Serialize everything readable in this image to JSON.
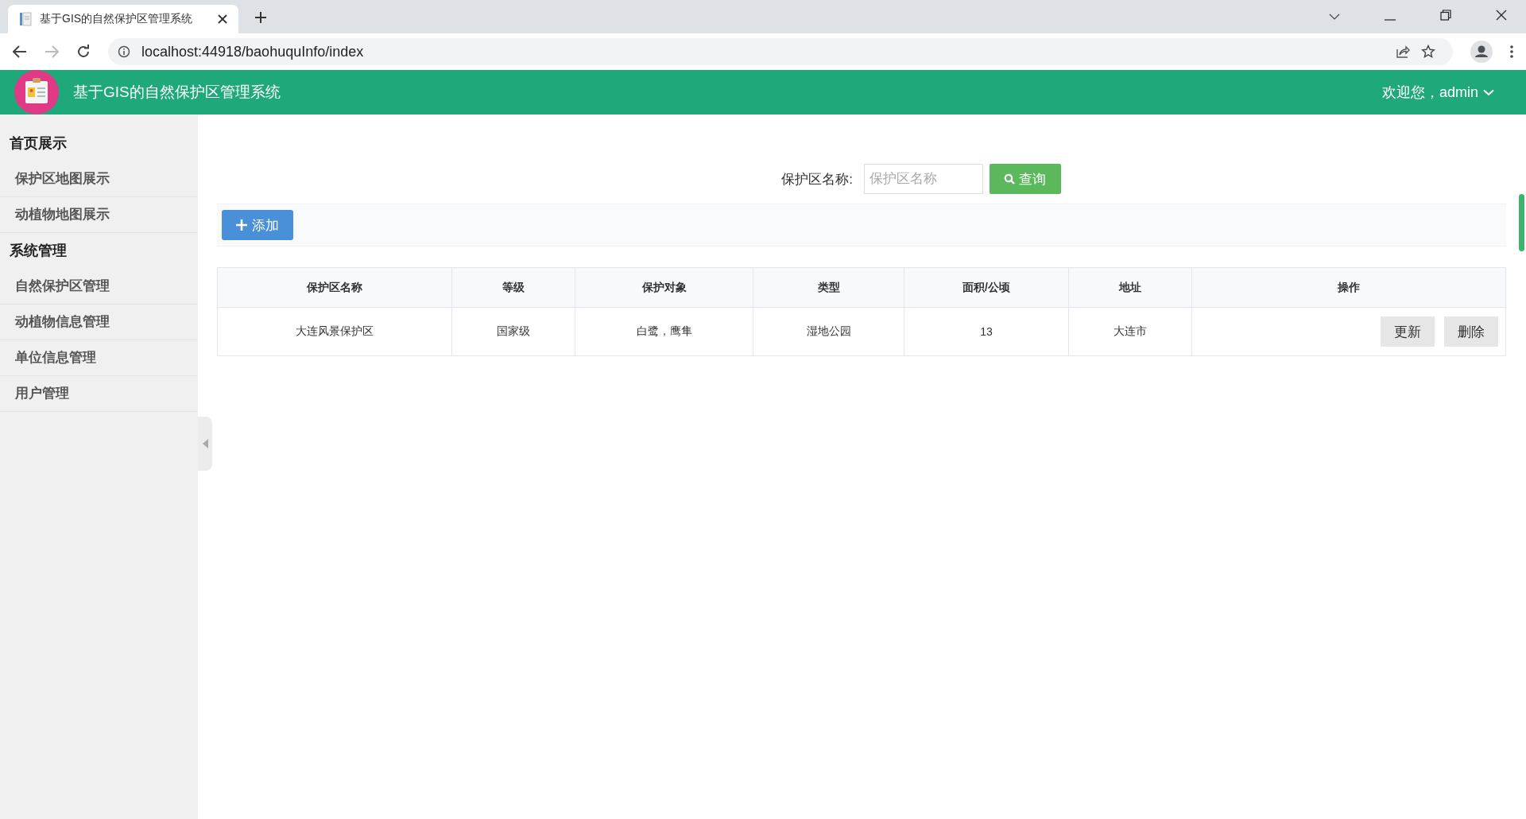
{
  "browser": {
    "tab_title": "基于GIS的自然保护区管理系统",
    "url": "localhost:44918/baohuquInfo/index"
  },
  "header": {
    "title": "基于GIS的自然保护区管理系统",
    "user_menu": "欢迎您，admin"
  },
  "sidebar": {
    "groups": [
      {
        "title": "首页展示",
        "items": [
          "保护区地图展示",
          "动植物地图展示"
        ]
      },
      {
        "title": "系统管理",
        "items": [
          "自然保护区管理",
          "动植物信息管理",
          "单位信息管理",
          "用户管理"
        ]
      }
    ]
  },
  "search": {
    "label": "保护区名称:",
    "placeholder": "保护区名称",
    "button": "查询"
  },
  "toolbar": {
    "add_button": "添加"
  },
  "table": {
    "columns": [
      "保护区名称",
      "等级",
      "保护对象",
      "类型",
      "面积/公顷",
      "地址",
      "操作"
    ],
    "rows": [
      {
        "cells": [
          "大连风景保护区",
          "国家级",
          "白鹭，鹰隼",
          "湿地公园",
          "13",
          "大连市"
        ],
        "actions": [
          "更新",
          "删除"
        ]
      }
    ]
  }
}
